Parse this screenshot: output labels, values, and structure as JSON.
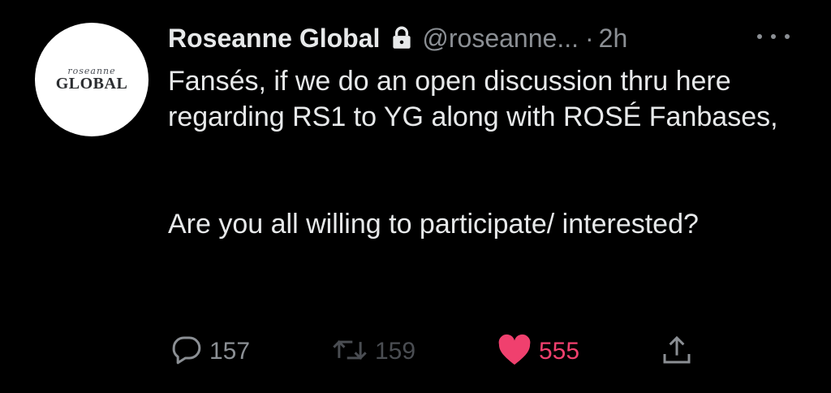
{
  "tweet": {
    "author": {
      "avatar_script": "roseanne",
      "avatar_word": "GLOBAL",
      "name": "Roseanne Global",
      "handle": "@roseanne...",
      "separator": "·",
      "time": "2h",
      "protected_icon": "lock-icon"
    },
    "more_icon": "more-icon",
    "text": {
      "line1": "Fansés, if we do an open discussion thru here regarding RS1 to YG along with ROSÉ Fanbases,",
      "line2": "Are you all willing to participate/ interested?"
    },
    "actions": {
      "reply": {
        "icon": "reply-icon",
        "count": "157"
      },
      "retweet": {
        "icon": "retweet-icon",
        "count": "159"
      },
      "like": {
        "icon": "heart-icon",
        "count": "555",
        "liked": true
      },
      "share": {
        "icon": "share-icon"
      }
    }
  },
  "colors": {
    "background": "#000000",
    "text": "#e7e9ea",
    "secondary": "#8b8f94",
    "like": "#f0406e"
  }
}
